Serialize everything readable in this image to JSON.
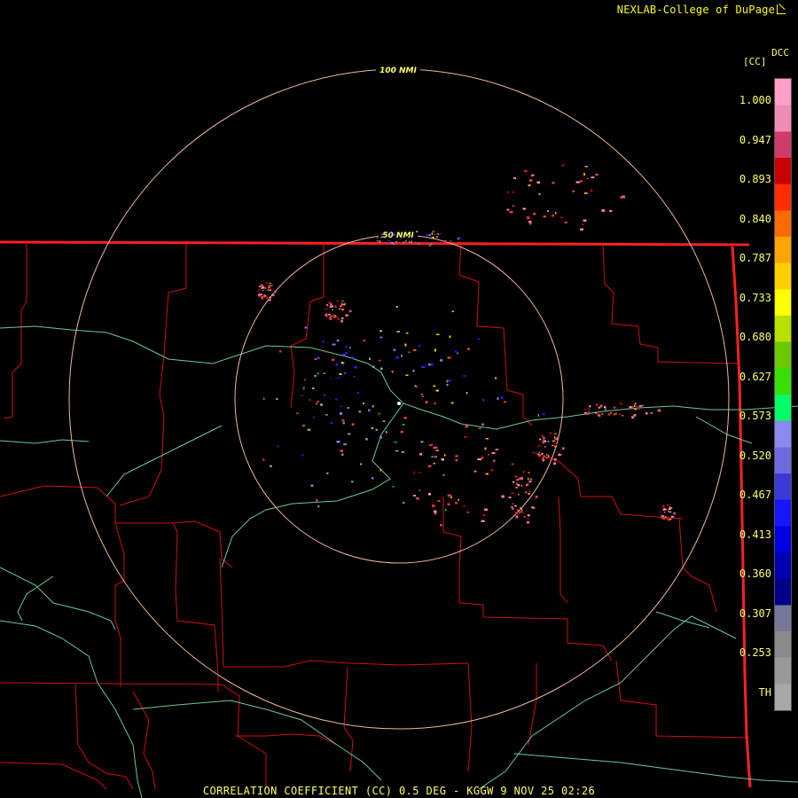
{
  "credit": {
    "text": "NEXLAB-College of DuPage",
    "icon": "corner-arrow-icon"
  },
  "legend": {
    "product_code": "DCC",
    "unit": "[CC]",
    "scale_labels": [
      "1.000",
      "0.947",
      "0.893",
      "0.840",
      "0.787",
      "0.733",
      "0.680",
      "0.627",
      "0.573",
      "0.520",
      "0.467",
      "0.413",
      "0.360",
      "0.307",
      "0.253",
      "TH"
    ],
    "colors": [
      "#ff9fc9",
      "#f08cb4",
      "#d23a6a",
      "#c80000",
      "#ff2d00",
      "#ff6a00",
      "#ffa500",
      "#ffd000",
      "#ffff00",
      "#b8e000",
      "#6cc800",
      "#37e000",
      "#00ff66",
      "#8a8af0",
      "#6c6ce0",
      "#3a3ad8",
      "#1616ff",
      "#0000e0",
      "#0000b0",
      "#00008a",
      "#777799",
      "#8a8a8a",
      "#999999",
      "#a8a8a8"
    ]
  },
  "range_rings": {
    "inner_label": "50 NMI",
    "outer_label": "100 NMI",
    "color": "#f0b89c"
  },
  "map_colors": {
    "state_boundary": "#ff2020",
    "county_boundary": "#d01010",
    "highway": "#6cc89a"
  },
  "footer": {
    "text": "CORRELATION COEFFICIENT (CC) 0.5 DEG - KGGW 9 NOV 25 02:26"
  }
}
